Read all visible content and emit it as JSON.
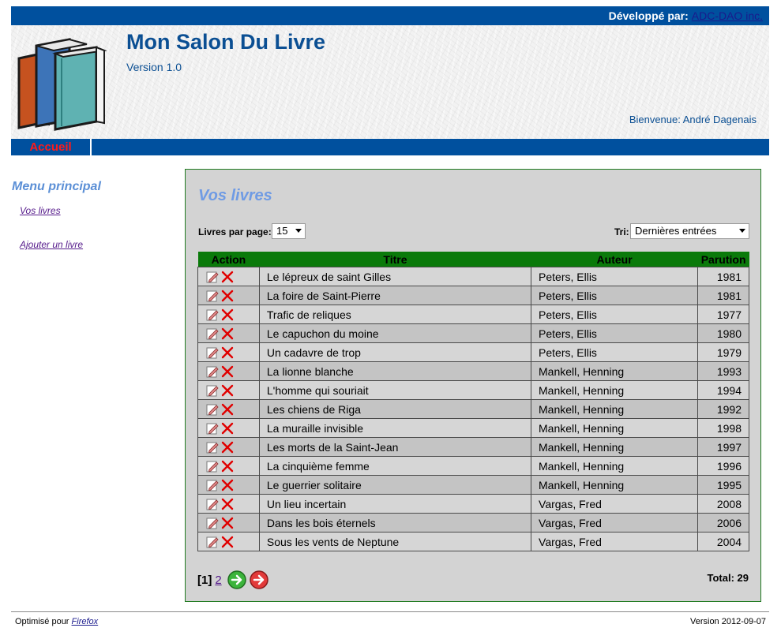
{
  "topbar": {
    "developed_by_label": "Développé par:",
    "developer_link": "ADC-DAO inc."
  },
  "header": {
    "title": "Mon Salon Du Livre",
    "version": "Version 1.0",
    "welcome": "Bienvenue: André Dagenais"
  },
  "nav": {
    "home": "Accueil"
  },
  "sidebar": {
    "title": "Menu principal",
    "items": [
      {
        "label": "Vos livres"
      },
      {
        "label": "Ajouter un livre"
      }
    ]
  },
  "main": {
    "title": "Vos livres",
    "per_page_label": "Livres par page:",
    "per_page_value": "15",
    "sort_label": "Tri:",
    "sort_value": "Dernières entrées",
    "columns": [
      "Action",
      "Titre",
      "Auteur",
      "Parution"
    ],
    "rows": [
      {
        "title": "Le lépreux de saint Gilles",
        "author": "Peters, Ellis",
        "year": "1981"
      },
      {
        "title": "La foire de Saint-Pierre",
        "author": "Peters, Ellis",
        "year": "1981"
      },
      {
        "title": "Trafic de reliques",
        "author": "Peters, Ellis",
        "year": "1977"
      },
      {
        "title": "Le capuchon du moine",
        "author": "Peters, Ellis",
        "year": "1980"
      },
      {
        "title": "Un cadavre de trop",
        "author": "Peters, Ellis",
        "year": "1979"
      },
      {
        "title": "La lionne blanche",
        "author": "Mankell, Henning",
        "year": "1993"
      },
      {
        "title": "L'homme qui souriait",
        "author": "Mankell, Henning",
        "year": "1994"
      },
      {
        "title": "Les chiens de Riga",
        "author": "Mankell, Henning",
        "year": "1992"
      },
      {
        "title": "La muraille invisible",
        "author": "Mankell, Henning",
        "year": "1998"
      },
      {
        "title": "Les morts de la Saint-Jean",
        "author": "Mankell, Henning",
        "year": "1997"
      },
      {
        "title": "La cinquième femme",
        "author": "Mankell, Henning",
        "year": "1996"
      },
      {
        "title": "Le guerrier solitaire",
        "author": "Mankell, Henning",
        "year": "1995"
      },
      {
        "title": "Un lieu incertain",
        "author": "Vargas, Fred",
        "year": "2008"
      },
      {
        "title": "Dans les bois éternels",
        "author": "Vargas, Fred",
        "year": "2006"
      },
      {
        "title": "Sous les vents de Neptune",
        "author": "Vargas, Fred",
        "year": "2004"
      }
    ],
    "pager": {
      "current": "[1]",
      "next_page": "2"
    },
    "total": "Total: 29"
  },
  "footer": {
    "optimized_label": "Optimisé pour",
    "browser_link": "Firefox",
    "version": "Version 2012-09-07"
  },
  "colors": {
    "primary": "#00509e",
    "header_text": "#0b4f93",
    "table_header": "#0a7a0a",
    "nav_active": "#ff1a1a",
    "panel_bg": "#d3d3d3"
  },
  "icons": {
    "row_edit": "edit-pencil-icon",
    "row_delete": "delete-x-icon",
    "next": "next-arrow-icon",
    "last": "last-arrow-icon"
  }
}
